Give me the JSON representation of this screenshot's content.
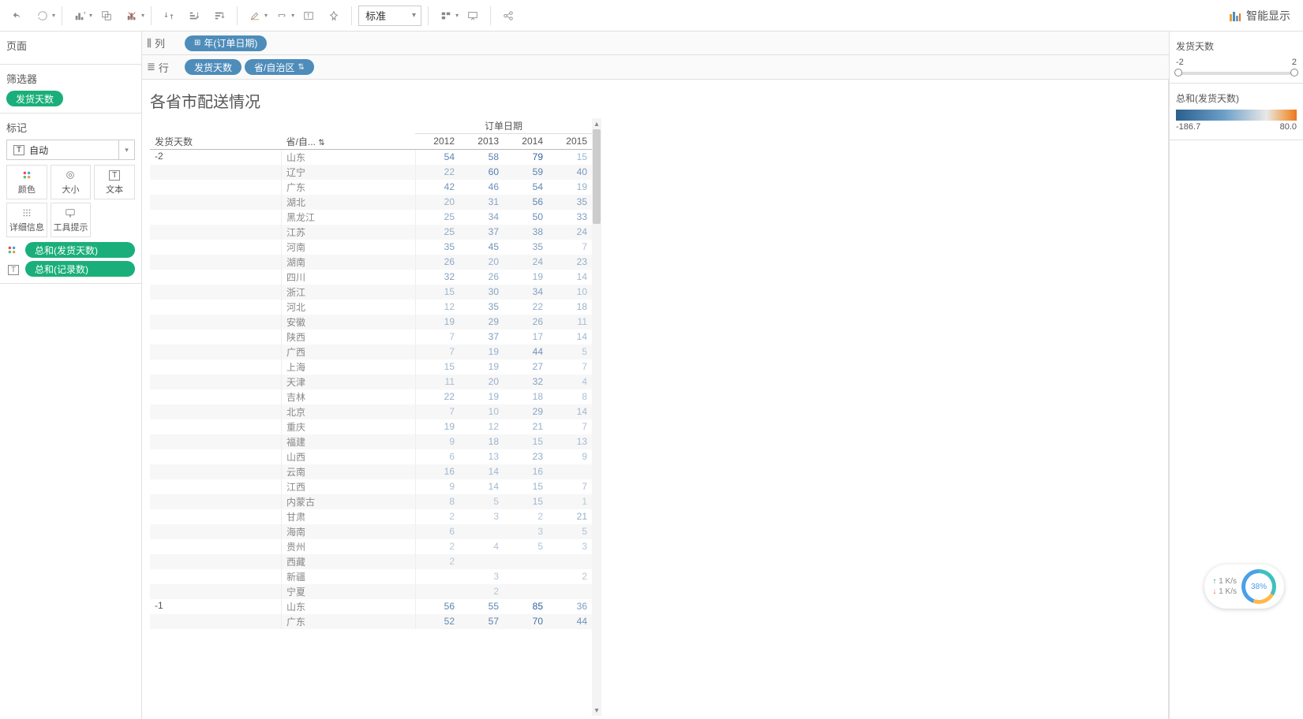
{
  "toolbar": {
    "fit_dropdown": "标准",
    "showme_label": "智能显示"
  },
  "shelves": {
    "columns_label": "列",
    "rows_label": "行",
    "columns_pills": [
      {
        "label": "年(订单日期)",
        "prefix": "⊞"
      }
    ],
    "rows_pills": [
      {
        "label": "发货天数",
        "sort": false
      },
      {
        "label": "省/自治区",
        "sort": true
      }
    ]
  },
  "left": {
    "pages_title": "页面",
    "filters_title": "筛选器",
    "filter_pill": "发货天数",
    "marks_title": "标记",
    "marks_select_label": "自动",
    "marks_select_icon": "T",
    "marks_cells": [
      {
        "icon_name": "color-dots-icon",
        "label": "颜色"
      },
      {
        "icon_name": "size-icon",
        "label": "大小"
      },
      {
        "icon_name": "text-icon",
        "label": "文本"
      },
      {
        "icon_name": "detail-icon",
        "label": "详细信息"
      },
      {
        "icon_name": "tooltip-icon",
        "label": "工具提示"
      }
    ],
    "encodings": [
      {
        "icon_name": "color-dots-icon",
        "label": "总和(发货天数)"
      },
      {
        "icon_name": "text-icon",
        "label": "总和(记录数)"
      }
    ]
  },
  "viz": {
    "title": "各省市配送情况",
    "col_super": "订单日期",
    "row_headers": [
      "发货天数",
      "省/自..."
    ],
    "year_headers": [
      "2012",
      "2013",
      "2014",
      "2015"
    ]
  },
  "legend": {
    "filter_title": "发货天数",
    "filter_min": "-2",
    "filter_max": "2",
    "color_title": "总和(发货天数)",
    "color_min": "-186.7",
    "color_max": "80.0"
  },
  "net": {
    "up": "1  K/s",
    "dn": "1  K/s",
    "pct": "38%"
  },
  "chart_data": {
    "type": "table",
    "title": "各省市配送情况",
    "row_dim_1": "发货天数",
    "row_dim_2": "省/自治区",
    "col_dim": "年(订单日期)",
    "years": [
      2012,
      2013,
      2014,
      2015
    ],
    "groups": [
      {
        "ship_days": -2,
        "rows": [
          {
            "province": "山东",
            "values": [
              54,
              58,
              79,
              15
            ]
          },
          {
            "province": "辽宁",
            "values": [
              22,
              60,
              59,
              40
            ]
          },
          {
            "province": "广东",
            "values": [
              42,
              46,
              54,
              19
            ]
          },
          {
            "province": "湖北",
            "values": [
              20,
              31,
              56,
              35
            ]
          },
          {
            "province": "黑龙江",
            "values": [
              25,
              34,
              50,
              33
            ]
          },
          {
            "province": "江苏",
            "values": [
              25,
              37,
              38,
              24
            ]
          },
          {
            "province": "河南",
            "values": [
              35,
              45,
              35,
              7
            ]
          },
          {
            "province": "湖南",
            "values": [
              26,
              20,
              24,
              23
            ]
          },
          {
            "province": "四川",
            "values": [
              32,
              26,
              19,
              14
            ]
          },
          {
            "province": "浙江",
            "values": [
              15,
              30,
              34,
              10
            ]
          },
          {
            "province": "河北",
            "values": [
              12,
              35,
              22,
              18
            ]
          },
          {
            "province": "安徽",
            "values": [
              19,
              29,
              26,
              11
            ]
          },
          {
            "province": "陕西",
            "values": [
              7,
              37,
              17,
              14
            ]
          },
          {
            "province": "广西",
            "values": [
              7,
              19,
              44,
              5
            ]
          },
          {
            "province": "上海",
            "values": [
              15,
              19,
              27,
              7
            ]
          },
          {
            "province": "天津",
            "values": [
              11,
              20,
              32,
              4
            ]
          },
          {
            "province": "吉林",
            "values": [
              22,
              19,
              18,
              8
            ]
          },
          {
            "province": "北京",
            "values": [
              7,
              10,
              29,
              14
            ]
          },
          {
            "province": "重庆",
            "values": [
              19,
              12,
              21,
              7
            ]
          },
          {
            "province": "福建",
            "values": [
              9,
              18,
              15,
              13
            ]
          },
          {
            "province": "山西",
            "values": [
              6,
              13,
              23,
              9
            ]
          },
          {
            "province": "云南",
            "values": [
              16,
              14,
              16,
              null
            ]
          },
          {
            "province": "江西",
            "values": [
              9,
              14,
              15,
              7
            ]
          },
          {
            "province": "内蒙古",
            "values": [
              8,
              5,
              15,
              1
            ]
          },
          {
            "province": "甘肃",
            "values": [
              2,
              3,
              2,
              21
            ]
          },
          {
            "province": "海南",
            "values": [
              6,
              null,
              3,
              5
            ]
          },
          {
            "province": "贵州",
            "values": [
              2,
              4,
              5,
              3
            ]
          },
          {
            "province": "西藏",
            "values": [
              2,
              null,
              null,
              null
            ]
          },
          {
            "province": "新疆",
            "values": [
              null,
              3,
              null,
              2
            ]
          },
          {
            "province": "宁夏",
            "values": [
              null,
              2,
              null,
              null
            ]
          }
        ]
      },
      {
        "ship_days": -1,
        "rows": [
          {
            "province": "山东",
            "values": [
              56,
              55,
              85,
              36
            ]
          },
          {
            "province": "广东",
            "values": [
              52,
              57,
              70,
              44
            ]
          }
        ]
      }
    ]
  }
}
